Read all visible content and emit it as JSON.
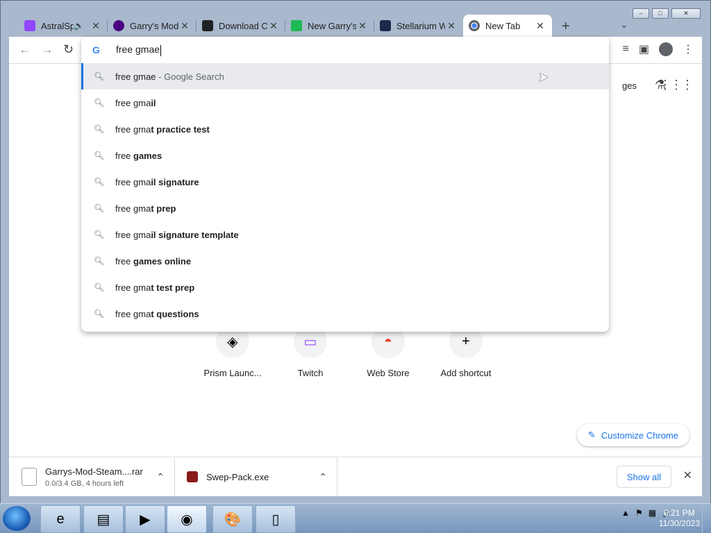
{
  "browser": {
    "tabs": [
      {
        "title": "AstralSpace",
        "favicon": "twitch-icon",
        "color": "#9146ff",
        "muted_icon": "speaker-icon"
      },
      {
        "title": "Garry's Mod",
        "favicon": "garrysmod-icon",
        "color": "#4b0082"
      },
      {
        "title": "Download C",
        "favicon": "database-icon",
        "color": "#202124"
      },
      {
        "title": "New Garry's",
        "favicon": "arrow-icon",
        "color": "#1db954"
      },
      {
        "title": "Stellarium W",
        "favicon": "stellarium-icon",
        "color": "#1b2a4a"
      },
      {
        "title": "New Tab",
        "favicon": "chrome-icon",
        "color": "#5f6368",
        "active": true
      }
    ],
    "omnibox": {
      "text": "free gmae",
      "suggestions": [
        {
          "prefix": "free gmae",
          "bold": "",
          "suffix": " - Google Search",
          "selected": true
        },
        {
          "prefix": "free gma",
          "bold": "il",
          "suffix": ""
        },
        {
          "prefix": "free gma",
          "bold": "t practice test",
          "suffix": ""
        },
        {
          "prefix": "free ",
          "bold": "games",
          "suffix": ""
        },
        {
          "prefix": "free gma",
          "bold": "il signature",
          "suffix": ""
        },
        {
          "prefix": "free gma",
          "bold": "t prep",
          "suffix": ""
        },
        {
          "prefix": "free gma",
          "bold": "il signature template",
          "suffix": ""
        },
        {
          "prefix": "free ",
          "bold": "games online",
          "suffix": ""
        },
        {
          "prefix": "free gma",
          "bold": "t test prep",
          "suffix": ""
        },
        {
          "prefix": "free gma",
          "bold": "t questions",
          "suffix": ""
        }
      ]
    },
    "ntp": {
      "images_link": "ges",
      "shortcuts": [
        {
          "label": "Prism Launc...",
          "icon": "prism-icon"
        },
        {
          "label": "Twitch",
          "icon": "twitch-icon"
        },
        {
          "label": "Web Store",
          "icon": "webstore-icon"
        },
        {
          "label": "Add shortcut",
          "icon": "plus-icon"
        }
      ],
      "customize_label": "Customize Chrome"
    },
    "downloads": {
      "items": [
        {
          "name": "Garrys-Mod-Steam....rar",
          "status": "0.0/3.4 GB, 4 hours left"
        },
        {
          "name": "Swep-Pack.exe",
          "status": ""
        }
      ],
      "show_all": "Show all"
    }
  },
  "taskbar": {
    "clock_time": "6:21 PM",
    "clock_date": "11/30/2023"
  }
}
